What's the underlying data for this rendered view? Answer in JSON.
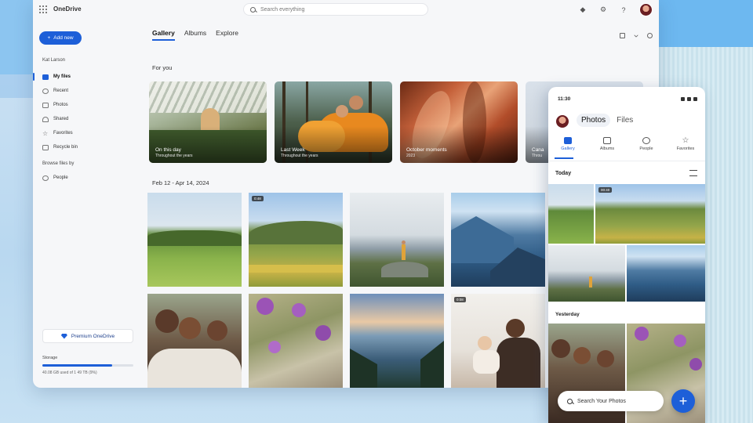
{
  "app": {
    "title": "OneDrive"
  },
  "search": {
    "placeholder": "Search everything"
  },
  "sidebar": {
    "add_new": "Add new",
    "user": "Kat Larson",
    "items": [
      {
        "label": "My files",
        "icon": "folder-icon",
        "active": true
      },
      {
        "label": "Recent",
        "icon": "clock-icon"
      },
      {
        "label": "Photos",
        "icon": "image-icon"
      },
      {
        "label": "Shared",
        "icon": "people-icon"
      },
      {
        "label": "Favorites",
        "icon": "star-icon"
      },
      {
        "label": "Recycle bin",
        "icon": "trash-icon"
      }
    ],
    "browse_by": "Browse files by",
    "people": "People",
    "premium": "Premium OneDrive",
    "storage_label": "Storage",
    "storage_fraction": 0.77,
    "storage_text": "40.08 GB used of 1 49 TB (9%)"
  },
  "main": {
    "tabs": [
      "Gallery",
      "Albums",
      "Explore"
    ],
    "for_you": "For you",
    "memories": [
      {
        "caption": "On this day",
        "sub": "Throughout the years"
      },
      {
        "caption": "Last Week",
        "sub": "Throughout the years"
      },
      {
        "caption": "October moments",
        "sub": "2023"
      },
      {
        "caption": "Cana",
        "sub": "Throu"
      }
    ],
    "date_range": "Feb 12 - Apr 14, 2024",
    "video_badges": [
      "0:48",
      "0:08"
    ]
  },
  "phone": {
    "time": "11:30",
    "toggle": [
      "Photos",
      "Files"
    ],
    "nav": [
      "Gallery",
      "Albums",
      "People",
      "Favorites"
    ],
    "today": "Today",
    "video_badge": "00:40",
    "yesterday": "Yesterday",
    "search": "Search Your Photos",
    "fab": "+"
  },
  "colors": {
    "accent": "#1d5fd8"
  }
}
